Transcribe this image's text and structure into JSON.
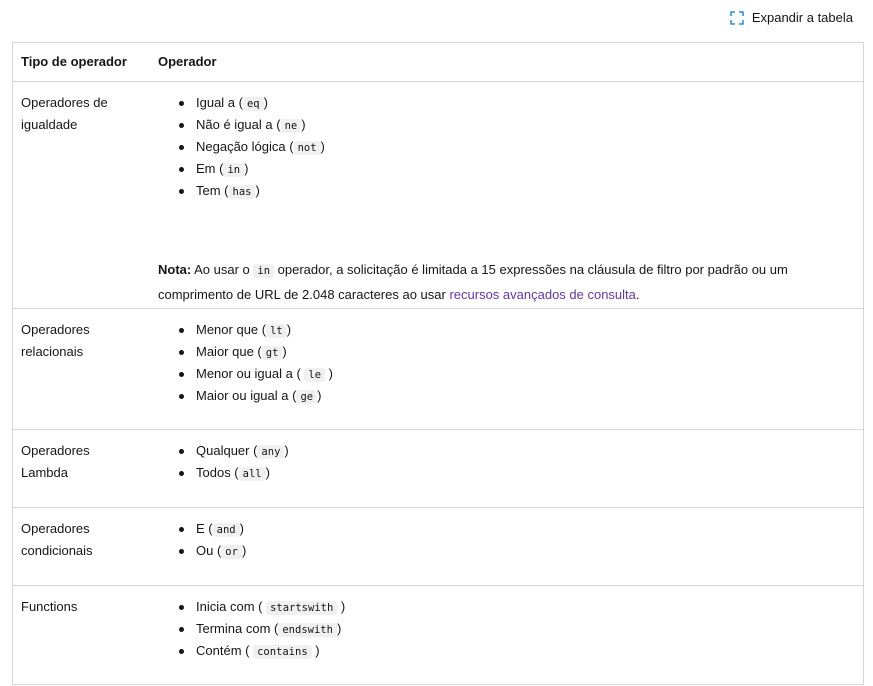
{
  "expand_label": "Expandir a tabela",
  "headers": {
    "type": "Tipo de operador",
    "operator": "Operador"
  },
  "rows": [
    {
      "type_line1": "Operadores de",
      "type_line2": "igualdade",
      "items": [
        {
          "text": "Igual a (",
          "code": "eq",
          "after": ")"
        },
        {
          "text": "Não é igual a (",
          "code": "ne",
          "after": ")"
        },
        {
          "text": "Negação lógica (",
          "code": "not",
          "after": ")"
        },
        {
          "text": "Em (",
          "code": "in",
          "after": ")"
        },
        {
          "text": "Tem (",
          "code": "has",
          "after": ")"
        }
      ],
      "note": {
        "label": "Nota:",
        "before": " Ao usar o ",
        "code": "in",
        "middle": " operador, a solicitação é limitada a 15 expressões na cláusula de filtro por padrão ou um comprimento de URL de 2.048 caracteres ao usar ",
        "link": "recursos avançados de consulta",
        "after": "."
      }
    },
    {
      "type_line1": "Operadores",
      "type_line2": "relacionais",
      "items": [
        {
          "text": "Menor que (",
          "code": "lt",
          "after": ")"
        },
        {
          "text": "Maior que (",
          "code": "gt",
          "after": ")"
        },
        {
          "text": "Menor ou igual a ( ",
          "code": "le",
          "after": " )"
        },
        {
          "text": "Maior ou igual a (",
          "code": "ge",
          "after": ")"
        }
      ]
    },
    {
      "type_line1": "Operadores",
      "type_line2": "Lambda",
      "items": [
        {
          "text": "Qualquer (",
          "code": "any",
          "after": ")"
        },
        {
          "text": "Todos (",
          "code": "all",
          "after": ")"
        }
      ]
    },
    {
      "type_line1": "Operadores",
      "type_line2": "condicionais",
      "items": [
        {
          "text": "E (",
          "code": "and",
          "after": ")"
        },
        {
          "text": "Ou (",
          "code": "or",
          "after": ")"
        }
      ]
    },
    {
      "type_line1": "Functions",
      "type_line2": "",
      "items": [
        {
          "text": "Inicia com ( ",
          "code": "startswith",
          "after": " )"
        },
        {
          "text": "Termina com (",
          "code": "endswith",
          "after": ")"
        },
        {
          "text": "Contém ( ",
          "code": "contains",
          "after": " )"
        }
      ]
    }
  ]
}
